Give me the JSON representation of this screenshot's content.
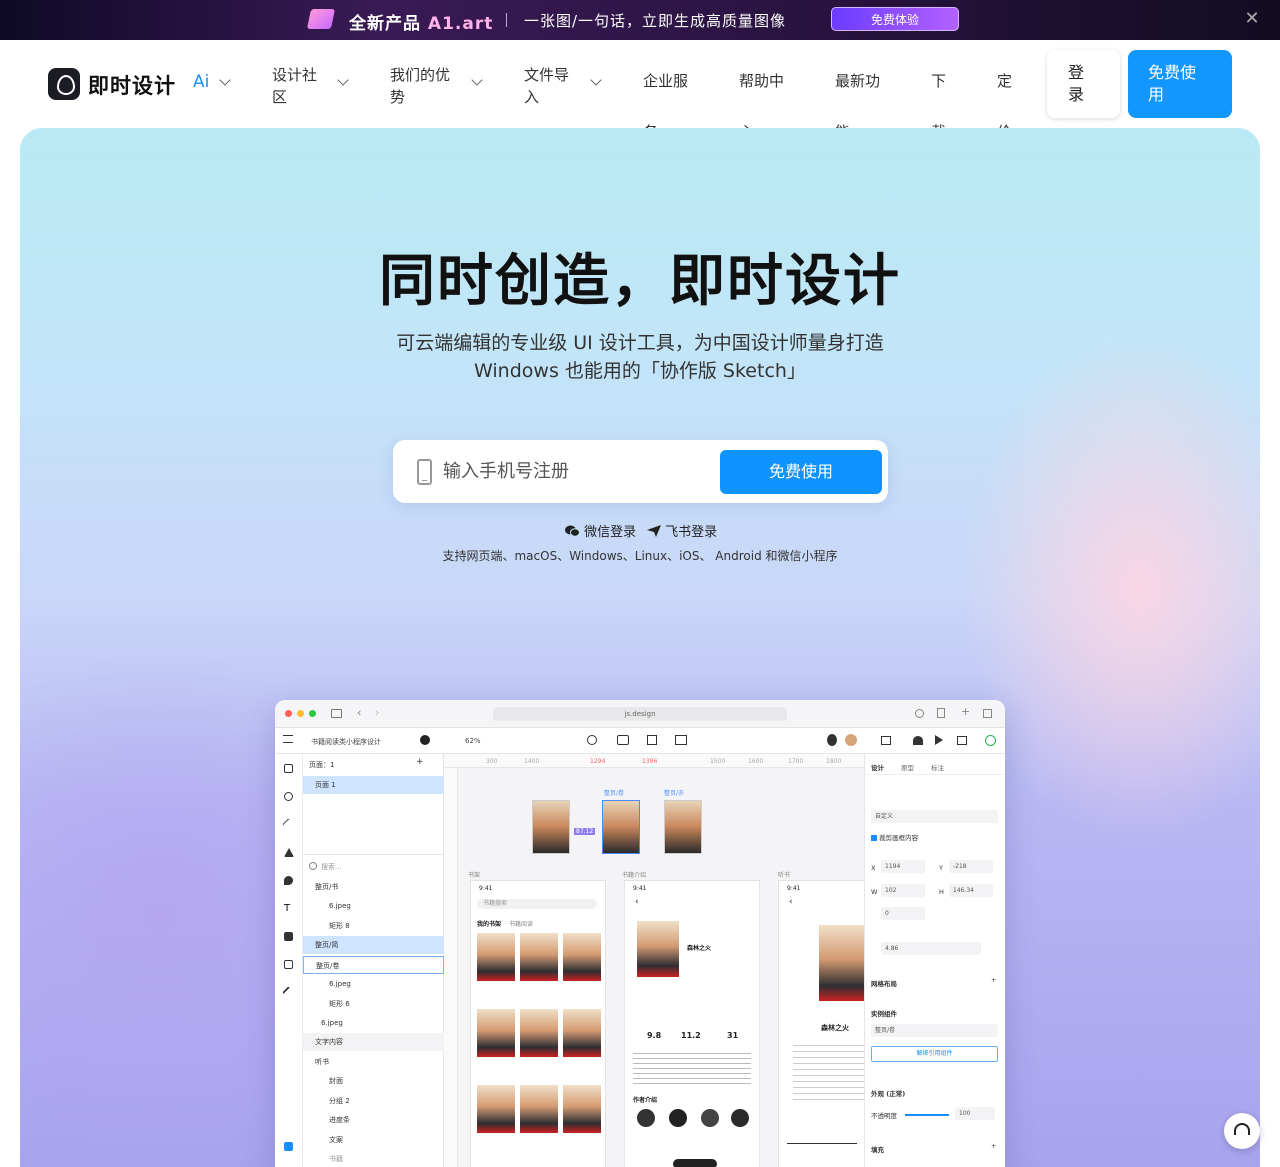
{
  "banner": {
    "product_prefix": "全新产品",
    "product_name": "A1.art",
    "tagline": "一张图/一句话，立即生成高质量图像",
    "cta": "免费体验",
    "close": "✕"
  },
  "nav": {
    "brand": "即时设计",
    "ai": "Ai",
    "items": [
      {
        "label": "设计社区"
      },
      {
        "label": "我们的优势"
      },
      {
        "label": "文件导入"
      },
      {
        "label": "企业服务"
      },
      {
        "label": "帮助中心"
      },
      {
        "label": "最新功能"
      },
      {
        "label": "下载"
      },
      {
        "label": "定价"
      }
    ],
    "login": "登录",
    "free": "免费使用"
  },
  "hero": {
    "title": "同时创造，即时设计",
    "subtitle_line1": "可云端编辑的专业级 UI 设计工具，为中国设计师量身打造",
    "subtitle_line2": "Windows 也能用的「协作版 Sketch」",
    "phone_placeholder": "输入手机号注册",
    "submit": "免费使用",
    "wechat_login": "微信登录",
    "feishu_login": "飞书登录",
    "platforms": "支持网页端、macOS、Windows、Linux、iOS、 Android 和微信小程序"
  },
  "app": {
    "url": "js.design",
    "file_name": "书籍阅读类小程序设计",
    "zoom": "62%",
    "pages_label": "页面：1",
    "page_item": "页面 1",
    "search_placeholder": "搜索...",
    "layers": [
      "整页/书",
      "6.jpeg",
      "矩形 8",
      "整页/简",
      "整页/卷",
      "6.jpeg",
      "矩形 6",
      "6.jpeg",
      "文字内容",
      "听书",
      "封面",
      "分组 2",
      "进度条",
      "文案",
      "书籍"
    ],
    "ruler_ticks": [
      "300",
      "1400",
      "1294",
      "1396",
      "1500",
      "1600",
      "1700",
      "1800"
    ],
    "measure": "87.12",
    "frame_labels": [
      "书架",
      "书籍介绍",
      "听书"
    ],
    "comp_labels": [
      "整页/卷",
      "整页/亦"
    ],
    "frame1": {
      "time": "9:41",
      "search": "书籍搜索",
      "tab_active": "我的书架",
      "tab_other": "书籍阅读"
    },
    "frame2": {
      "time": "9:41",
      "book_title": "森林之火",
      "score": "9.8",
      "count": "11.2",
      "words": "31",
      "section": "作者介绍"
    },
    "frame3": {
      "time": "9:41",
      "book_title": "森林之火"
    },
    "props": {
      "tabs": [
        "设计",
        "原型",
        "标注"
      ],
      "frame_type": "自定义",
      "clip": "裁剪画框内容",
      "x_label": "X",
      "x": "1194",
      "y_label": "Y",
      "y": "-218",
      "w_label": "W",
      "w": "102",
      "h_label": "H",
      "h": "146.34",
      "rotation": "0",
      "radius": "4.86",
      "grid": "网格布局",
      "instance": "实例组件",
      "instance_name": "整页/卷",
      "detach": "解绑引用组件",
      "appearance": "外观 (正常)",
      "opacity_label": "不透明度",
      "opacity": "100",
      "fill": "填充"
    }
  },
  "colors": {
    "accent": "#0e93ff",
    "banner_bg": "#1a1030",
    "hero_top": "#b8e9f4",
    "hero_bottom": "#a9a3ee"
  }
}
